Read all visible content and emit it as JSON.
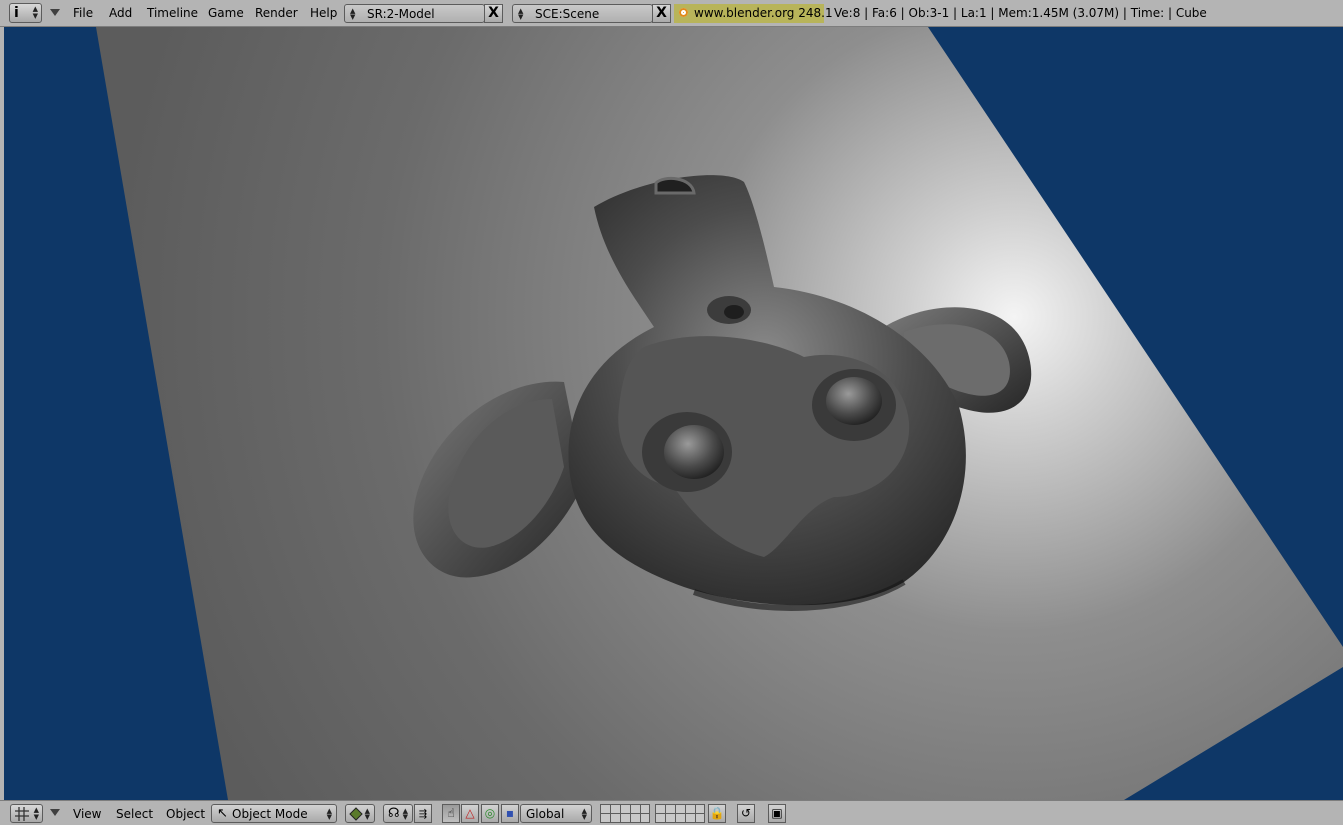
{
  "top_header": {
    "menus": [
      "File",
      "Add",
      "Timeline",
      "Game",
      "Render",
      "Help"
    ],
    "screen_field": "SR:2-Model",
    "scene_field": "SCE:Scene",
    "site_badge": "www.blender.org 248.1",
    "stats": "Ve:8 | Fa:6 | Ob:3-1 | La:1  | Mem:1.45M (3.07M)  | Time: | Cube",
    "close_glyph": "X",
    "info_glyph": "i"
  },
  "bottom_header": {
    "menus": [
      "View",
      "Select",
      "Object"
    ],
    "mode": "Object Mode",
    "orientation": "Global"
  },
  "colors": {
    "header_bg": "#b4b4b4",
    "viewport_bg": "#0e3767",
    "site_badge_bg": "#b8b45a"
  },
  "icons": {
    "editor_type": "info-icon",
    "viewport_editor_type": "grid-icon",
    "mode_icon": "object-mode-icon",
    "shading": "solid-shading-icon",
    "pivot": "pivot-icon",
    "manipulator": [
      "hand-icon",
      "translate-icon",
      "rotate-icon",
      "scale-icon"
    ],
    "lock": "lock-icon",
    "render": "render-preview-icon"
  }
}
